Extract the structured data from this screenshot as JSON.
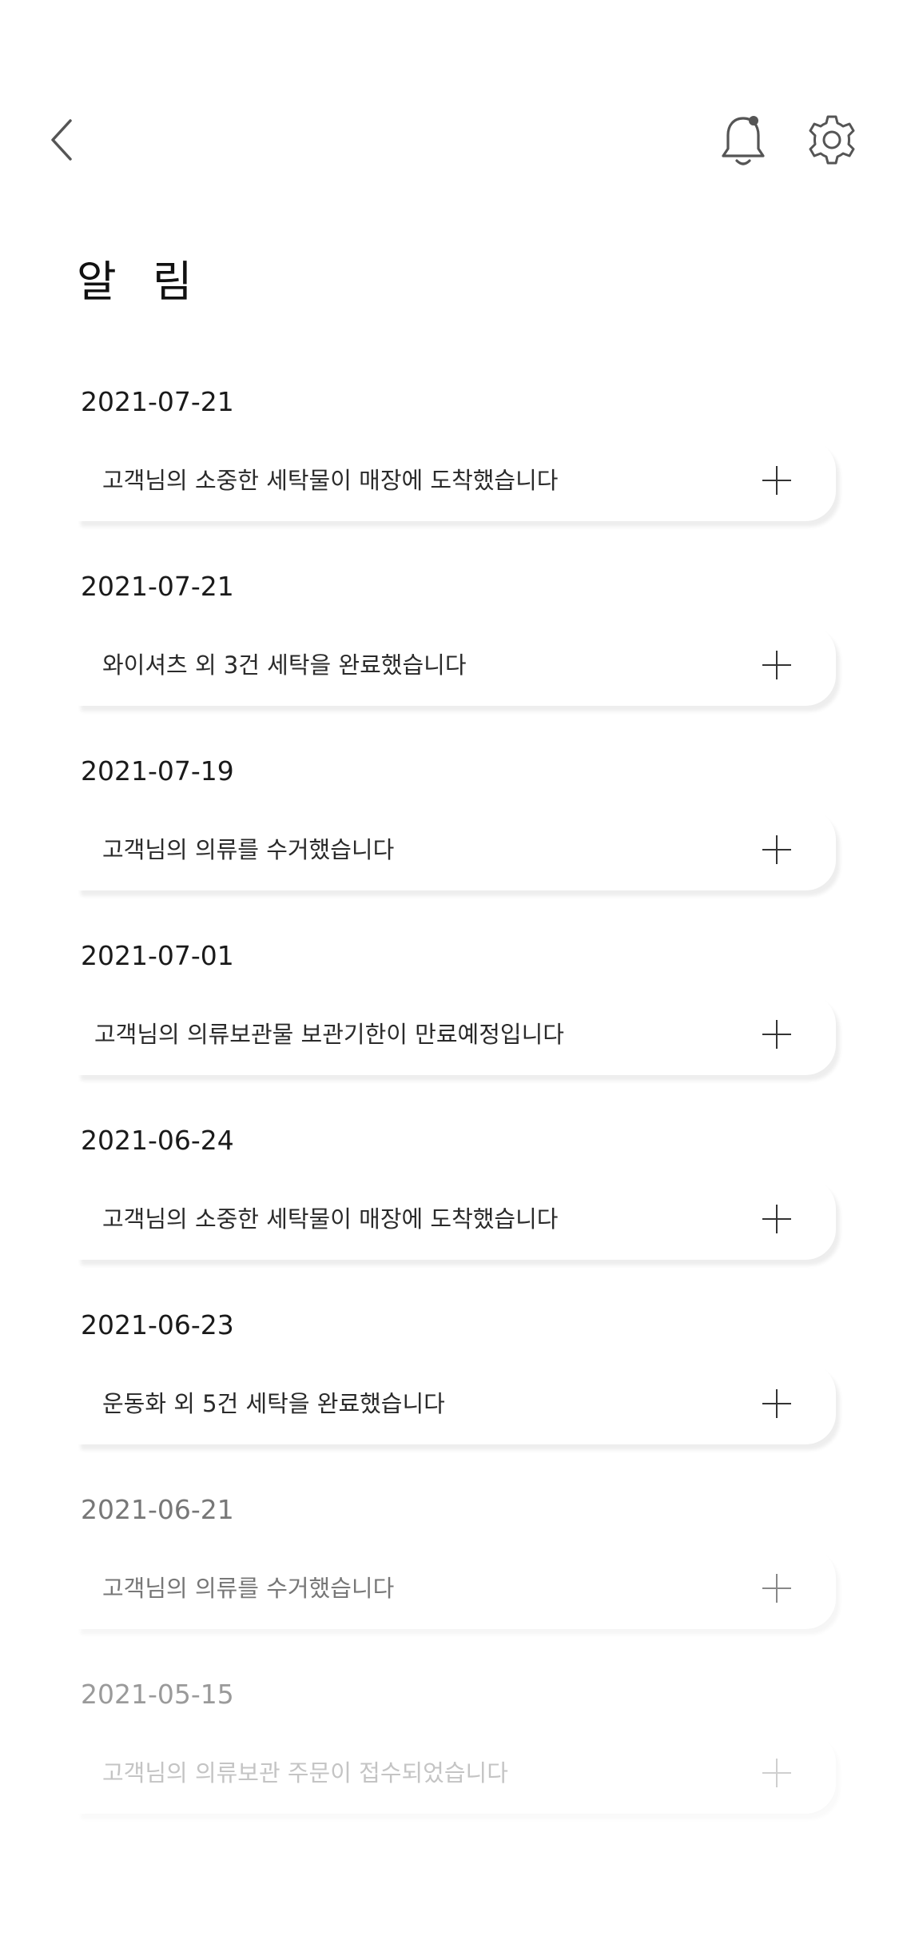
{
  "header": {
    "title": "알 림",
    "icons": {
      "back": "chevron-left-icon",
      "notification": "bell-icon",
      "settings": "gear-icon"
    }
  },
  "notifications": [
    {
      "date": "2021-07-21",
      "message": "고객님의 소중한 세탁물이 매장에 도착했습니다"
    },
    {
      "date": "2021-07-21",
      "message": "와이셔츠 외 3건 세탁을 완료했습니다"
    },
    {
      "date": "2021-07-19",
      "message": "고객님의 의류를 수거했습니다"
    },
    {
      "date": "2021-07-01",
      "message": "고객님의 의류보관물 보관기한이 만료예정입니다"
    },
    {
      "date": "2021-06-24",
      "message": "고객님의 소중한 세탁물이 매장에 도착했습니다"
    },
    {
      "date": "2021-06-23",
      "message": "운동화 외 5건 세탁을 완료했습니다"
    },
    {
      "date": "2021-06-21",
      "message": "고객님의 의류를 수거했습니다"
    },
    {
      "date": "2021-05-15",
      "message": "고객님의 의류보관 주문이 접수되었습니다"
    }
  ],
  "colors": {
    "background": "#ffffff",
    "text": "#222222",
    "icon": "#555555"
  }
}
